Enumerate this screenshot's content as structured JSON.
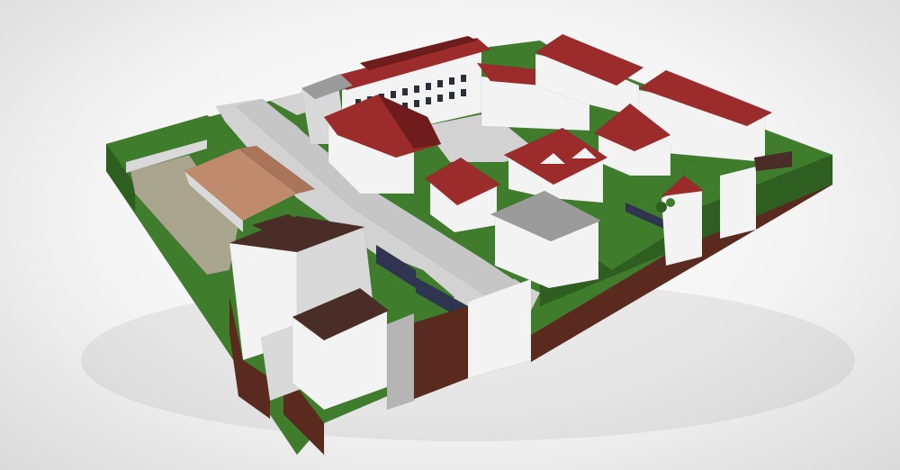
{
  "scene": {
    "subject": "city-block-3d-model",
    "colors": {
      "background": "#f2f2f2",
      "grass": "#3f7d2c",
      "grass_dark": "#2e5e20",
      "soil": "#5b2a1e",
      "road": "#d2d2d2",
      "wall": "#f3f3f3",
      "wall_shade": "#d9d9d9",
      "roof_red": "#9c2b2b",
      "roof_red_dark": "#6f1c1c",
      "roof_brown": "#4a2d27",
      "roof_grey": "#9b9b9b",
      "roof_wood": "#c08a6d",
      "stone": "#a9a48d",
      "fence": "#2f3550"
    },
    "icons": [
      "building-icon",
      "roof-icon",
      "tree-icon"
    ]
  }
}
